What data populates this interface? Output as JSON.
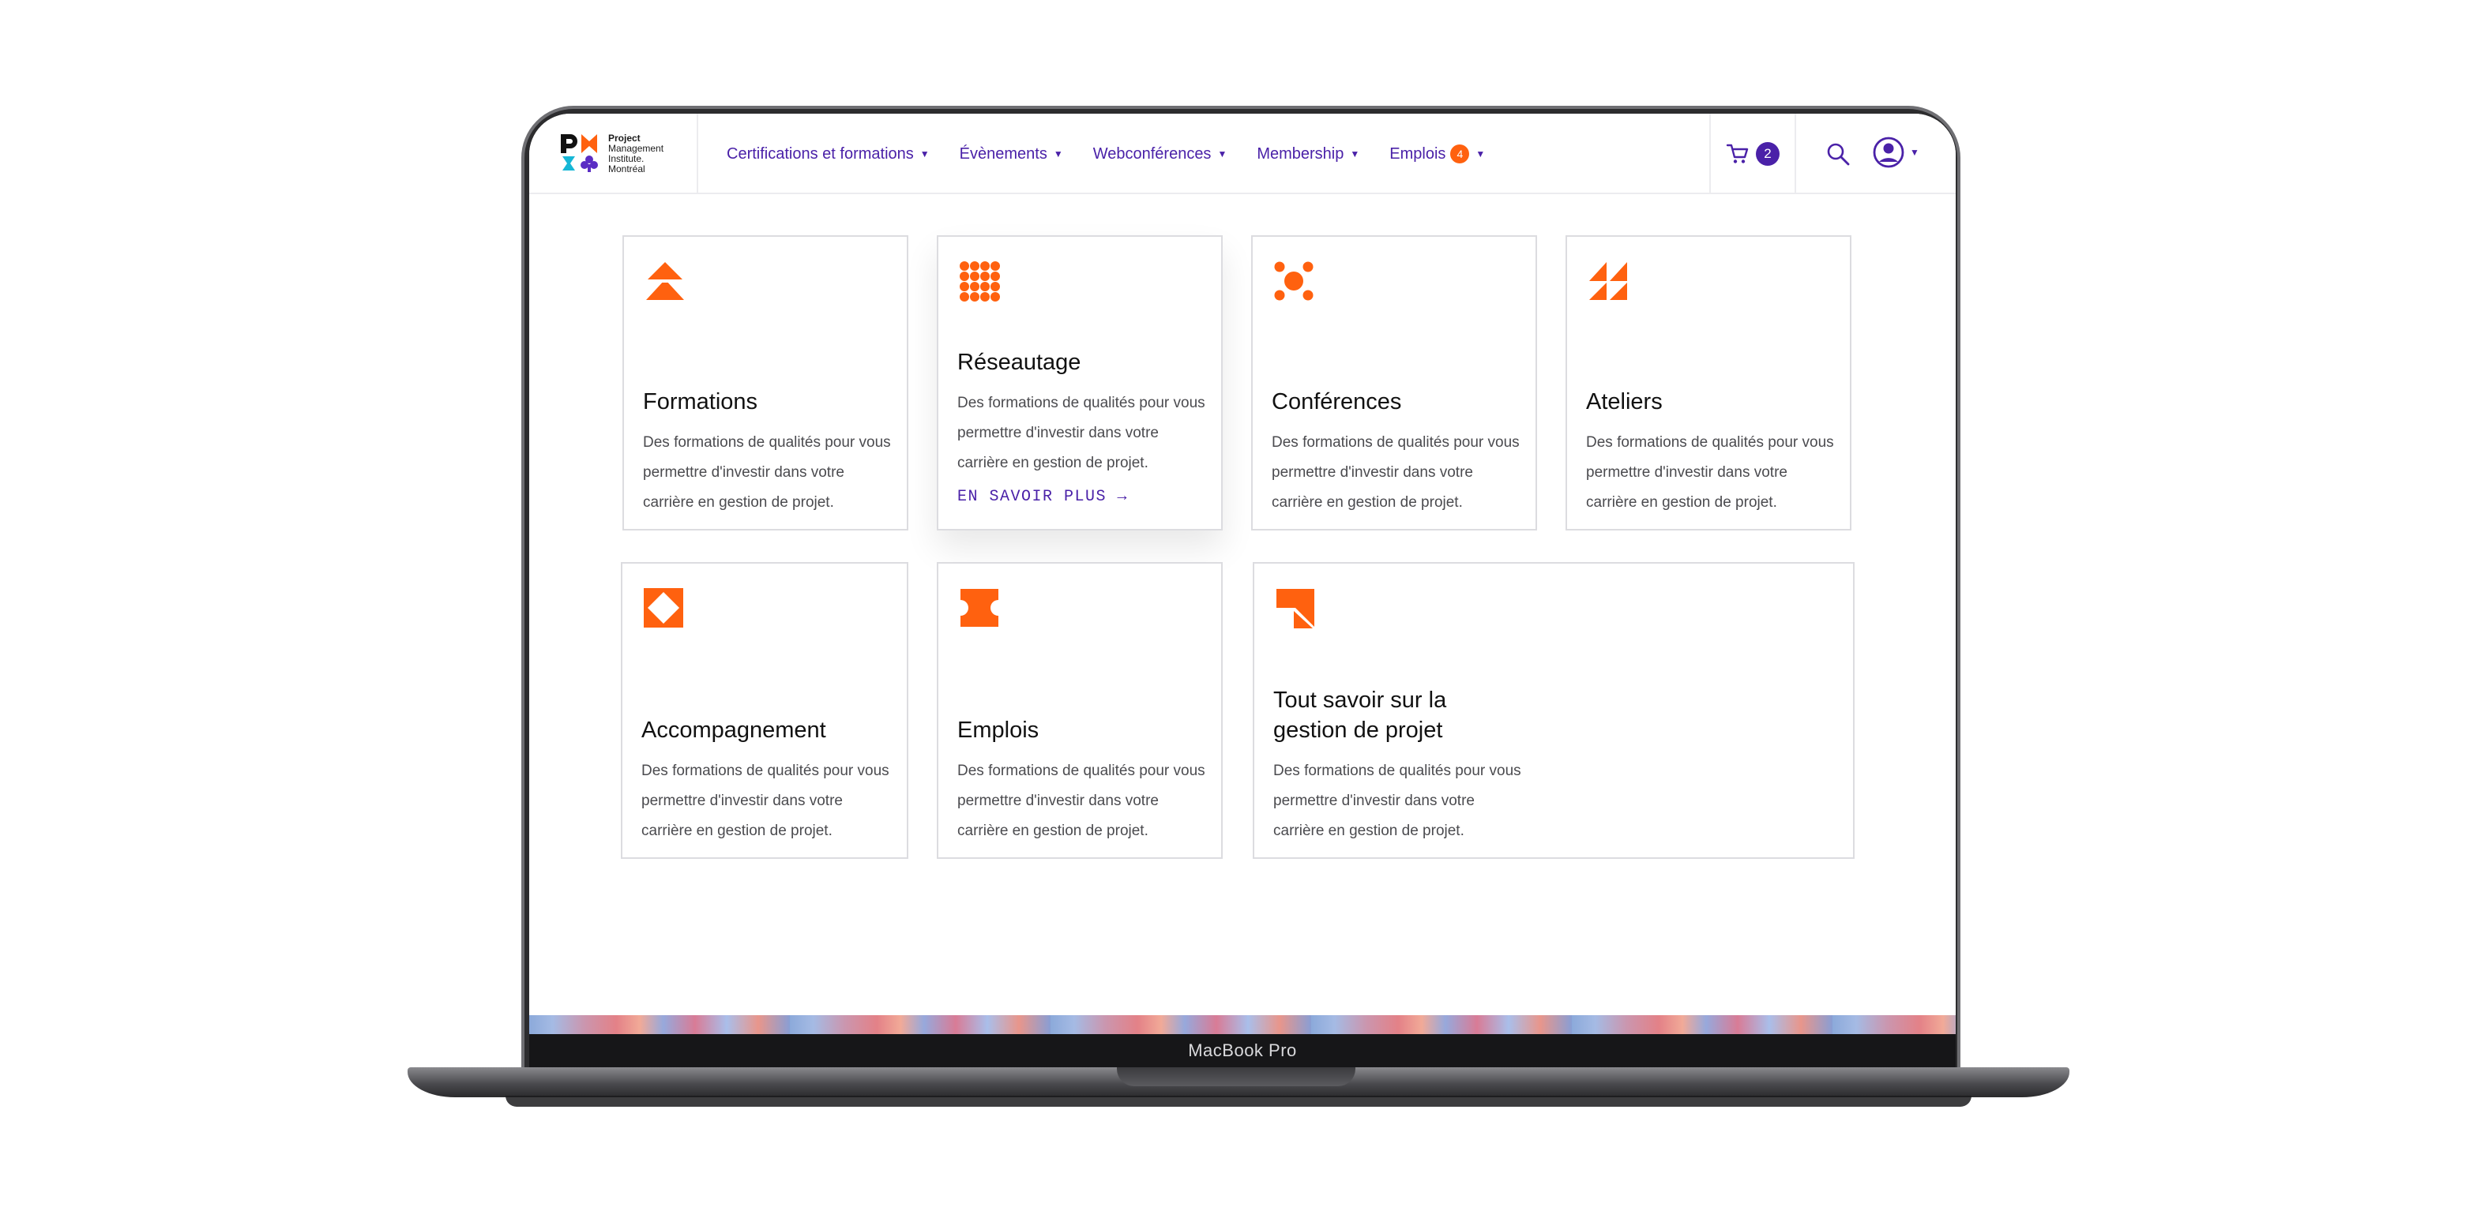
{
  "device": {
    "label": "MacBook Pro"
  },
  "logo": {
    "line1": "Project",
    "line2": "Management",
    "line3": "Institute.",
    "line4": "Montréal"
  },
  "nav": {
    "items": [
      {
        "label": "Certifications et formations"
      },
      {
        "label": "Évènements"
      },
      {
        "label": "Webconférences"
      },
      {
        "label": "Membership"
      },
      {
        "label": "Emplois",
        "badge": "4"
      }
    ],
    "cart_count": "2"
  },
  "cards": [
    {
      "title": "Formations",
      "desc": "Des formations de qualités pour vous permettre d'investir dans votre carrière en gestion de projet.",
      "icon": "double-triangle-up-icon"
    },
    {
      "title": "Réseautage",
      "desc": "Des formations de qualités pour vous permettre d'investir dans votre carrière en gestion de projet.",
      "link": "EN SAVOIR PLUS →",
      "icon": "dot-grid-icon"
    },
    {
      "title": "Conférences",
      "desc": "Des formations de qualités pour vous permettre d'investir dans votre carrière en gestion de projet.",
      "icon": "five-dots-icon"
    },
    {
      "title": "Ateliers",
      "desc": "Des formations de qualités pour vous permettre d'investir dans votre carrière en gestion de projet.",
      "icon": "triangles-icon"
    },
    {
      "title": "Accompagnement",
      "desc": "Des formations de qualités pour vous permettre d'investir dans votre carrière en gestion de projet.",
      "icon": "diamond-cutout-icon"
    },
    {
      "title": "Emplois",
      "desc": "Des formations de qualités pour vous permettre d'investir dans votre carrière en gestion de projet.",
      "icon": "ticket-icon"
    },
    {
      "title_line1": "Tout savoir sur la",
      "title_line2": "gestion de projet",
      "desc": "Des formations de qualités pour vous permettre d'investir dans votre carrière en gestion de projet.",
      "icon": "flag-arrow-icon"
    }
  ],
  "colors": {
    "accent": "#4a21a8",
    "brand_orange": "#ff610f",
    "teal": "#16b7d6",
    "purple": "#5b2dc4"
  }
}
